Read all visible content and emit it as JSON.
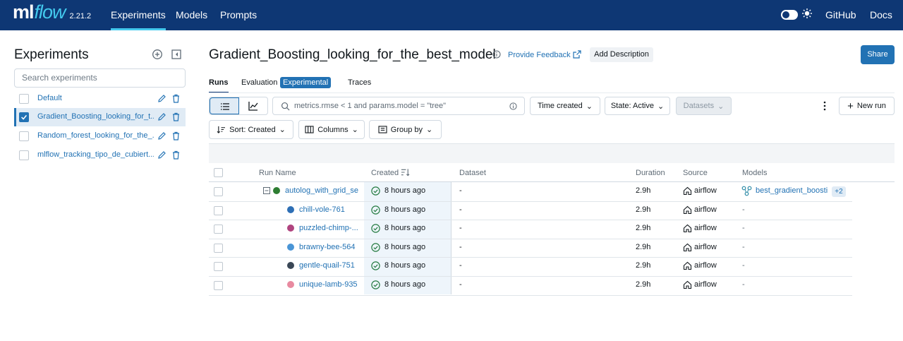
{
  "topbar": {
    "logo_ml": "ml",
    "logo_flow": "flow",
    "version": "2.21.2",
    "nav": [
      "Experiments",
      "Models",
      "Prompts"
    ],
    "github": "GitHub",
    "docs": "Docs"
  },
  "sidebar": {
    "title": "Experiments",
    "search_placeholder": "Search experiments",
    "experiments": [
      {
        "label": "Default",
        "checked": false
      },
      {
        "label": "Gradient_Boosting_looking_for_t...",
        "checked": true
      },
      {
        "label": "Random_forest_looking_for_the_...",
        "checked": false
      },
      {
        "label": "mlflow_tracking_tipo_de_cubiert...",
        "checked": false
      }
    ]
  },
  "header": {
    "title": "Gradient_Boosting_looking_for_the_best_model",
    "feedback": "Provide Feedback",
    "add_description": "Add Description",
    "share": "Share"
  },
  "tabs": {
    "runs": "Runs",
    "evaluation": "Evaluation",
    "experimental": "Experimental",
    "traces": "Traces"
  },
  "toolbar": {
    "search_value": "metrics.rmse < 1 and params.model = \"tree\"",
    "time_created": "Time created",
    "state": "State: Active",
    "datasets": "Datasets",
    "new_run": "New run",
    "sort": "Sort: Created",
    "columns": "Columns",
    "group_by": "Group by"
  },
  "table": {
    "headers": {
      "run_name": "Run Name",
      "created": "Created",
      "dataset": "Dataset",
      "duration": "Duration",
      "source": "Source",
      "models": "Models"
    },
    "rows": [
      {
        "name": "autolog_with_grid_se...",
        "color": "#2e7d32",
        "created": "8 hours ago",
        "dataset": "-",
        "duration": "2.9h",
        "source": "airflow",
        "models": "best_gradient_boosti...",
        "models_extra": "+2"
      },
      {
        "name": "chill-vole-761",
        "color": "#2e6fb5",
        "created": "8 hours ago",
        "dataset": "-",
        "duration": "2.9h",
        "source": "airflow",
        "models": "-"
      },
      {
        "name": "puzzled-chimp-...",
        "color": "#b0447f",
        "created": "8 hours ago",
        "dataset": "-",
        "duration": "2.9h",
        "source": "airflow",
        "models": "-"
      },
      {
        "name": "brawny-bee-564",
        "color": "#4a95d6",
        "created": "8 hours ago",
        "dataset": "-",
        "duration": "2.9h",
        "source": "airflow",
        "models": "-"
      },
      {
        "name": "gentle-quail-751",
        "color": "#3a4756",
        "created": "8 hours ago",
        "dataset": "-",
        "duration": "2.9h",
        "source": "airflow",
        "models": "-"
      },
      {
        "name": "unique-lamb-935",
        "color": "#e88aa0",
        "created": "8 hours ago",
        "dataset": "-",
        "duration": "2.9h",
        "source": "airflow",
        "models": "-"
      }
    ]
  }
}
